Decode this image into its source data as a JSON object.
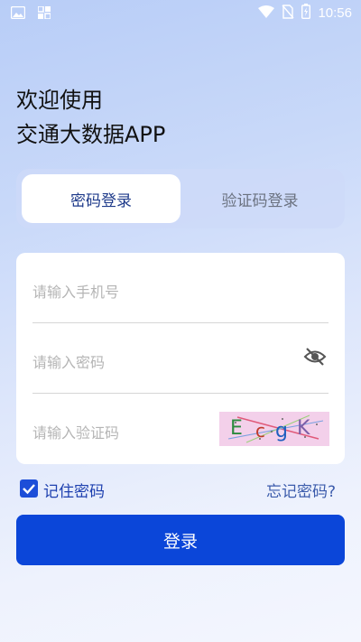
{
  "status_bar": {
    "time": "10:56",
    "left_icons": [
      "image-icon",
      "grid-icon"
    ],
    "right_icons": [
      "wifi-icon",
      "no-sim-icon",
      "battery-icon"
    ]
  },
  "welcome": {
    "line1": "欢迎使用",
    "line2": "交通大数据APP"
  },
  "tabs": [
    {
      "label": "密码登录",
      "active": true
    },
    {
      "label": "验证码登录",
      "active": false
    }
  ],
  "form": {
    "phone_placeholder": "请输入手机号",
    "password_placeholder": "请输入密码",
    "captcha_placeholder": "请输入验证码",
    "captcha_text": [
      "E",
      "c",
      "g",
      "K"
    ]
  },
  "options": {
    "remember_label": "记住密码",
    "remember_checked": true,
    "forgot_label": "忘记密码?"
  },
  "login_label": "登录",
  "colors": {
    "primary": "#0b46d9",
    "tab_active_text": "#1e3a8a",
    "captcha_bg": "#f3d0ea"
  }
}
